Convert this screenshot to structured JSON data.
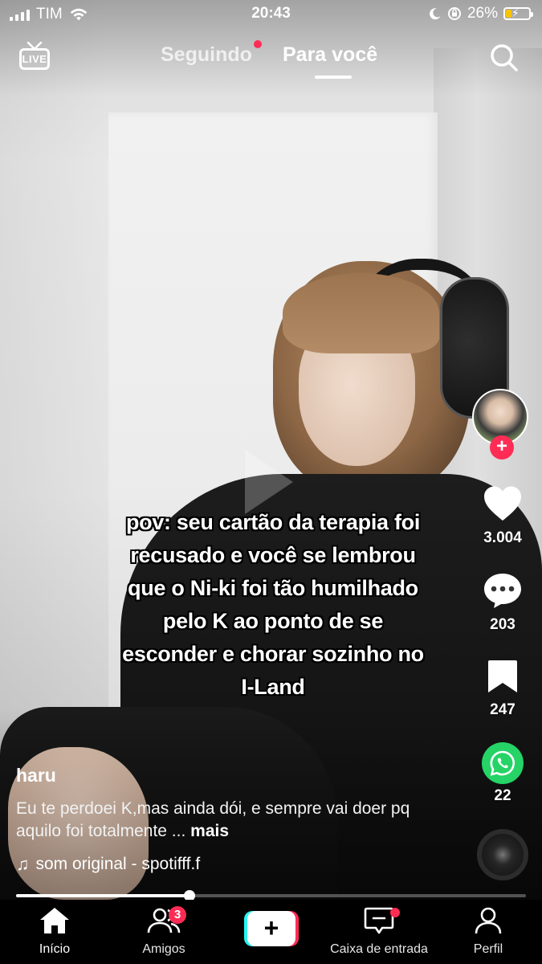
{
  "status_bar": {
    "carrier": "TIM",
    "time": "20:43",
    "battery_percent": "26%",
    "battery_level": 0.26
  },
  "top_nav": {
    "live_label": "LIVE",
    "following_label": "Seguindo",
    "for_you_label": "Para você",
    "active_tab": "Para você"
  },
  "caption": {
    "lines": [
      "pov: seu cartão da terapia foi",
      "recusado e você se lembrou",
      "que o Ni-ki foi tão humilhado",
      "pelo K ao ponto de se",
      "esconder e chorar sozinho no",
      "I-Land"
    ]
  },
  "actions": {
    "likes": "3.004",
    "comments": "203",
    "saves": "247",
    "shares": "22"
  },
  "post": {
    "username": "haru",
    "description": "Eu te perdoei K,mas ainda dói, e sempre vai doer pq aquilo foi totalmente ...",
    "more_label": "mais",
    "sound": "som original - spotifff.f",
    "progress": 0.34
  },
  "tab_bar": {
    "home_label": "Início",
    "friends_label": "Amigos",
    "friends_badge": "3",
    "inbox_label": "Caixa de entrada",
    "profile_label": "Perfil",
    "create_symbol": "+"
  },
  "colors": {
    "accent_red": "#fe2c55",
    "accent_cyan": "#25f4ee",
    "whatsapp_green": "#25d366",
    "battery_charging": "#f5c400"
  }
}
